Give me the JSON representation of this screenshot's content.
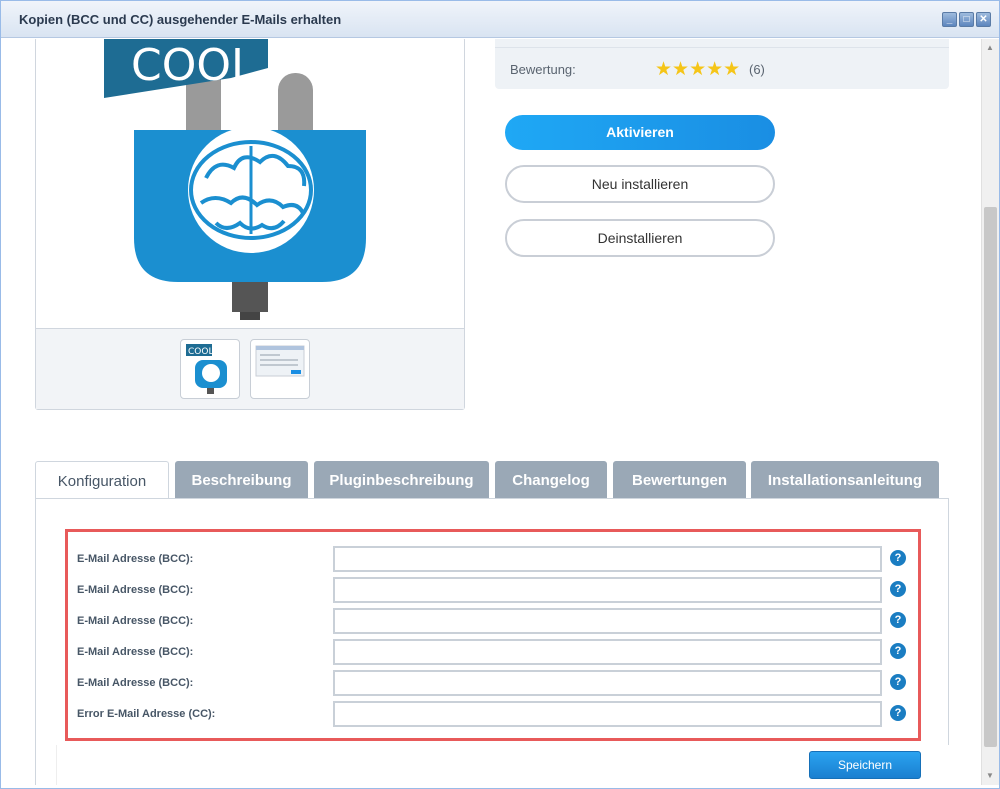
{
  "window": {
    "title": "Kopien (BCC und CC) ausgehender E-Mails erhalten"
  },
  "product_image": {
    "sign_text": "COOL",
    "thumb_sign_text": "COOL"
  },
  "rating": {
    "label": "Bewertung:",
    "stars": "★★★★★",
    "count": "(6)",
    "value": 5,
    "max": 5
  },
  "actions": {
    "activate": "Aktivieren",
    "reinstall": "Neu installieren",
    "uninstall": "Deinstallieren"
  },
  "tabs": [
    {
      "label": "Konfiguration"
    },
    {
      "label": "Beschreibung"
    },
    {
      "label": "Pluginbeschreibung"
    },
    {
      "label": "Changelog"
    },
    {
      "label": "Bewertungen"
    },
    {
      "label": "Installationsanleitung"
    }
  ],
  "form": {
    "rows": [
      {
        "label": "E-Mail Adresse (BCC):",
        "value": ""
      },
      {
        "label": "E-Mail Adresse (BCC):",
        "value": ""
      },
      {
        "label": "E-Mail Adresse (BCC):",
        "value": ""
      },
      {
        "label": "E-Mail Adresse (BCC):",
        "value": ""
      },
      {
        "label": "E-Mail Adresse (BCC):",
        "value": ""
      },
      {
        "label": "Error E-Mail Adresse (CC):",
        "value": ""
      }
    ],
    "help_glyph": "?",
    "save": "Speichern"
  },
  "colors": {
    "accent": "#1a8ee3",
    "highlight_border": "#e85a5a",
    "plug_blue": "#1b8fd0",
    "star": "#f5c518"
  }
}
